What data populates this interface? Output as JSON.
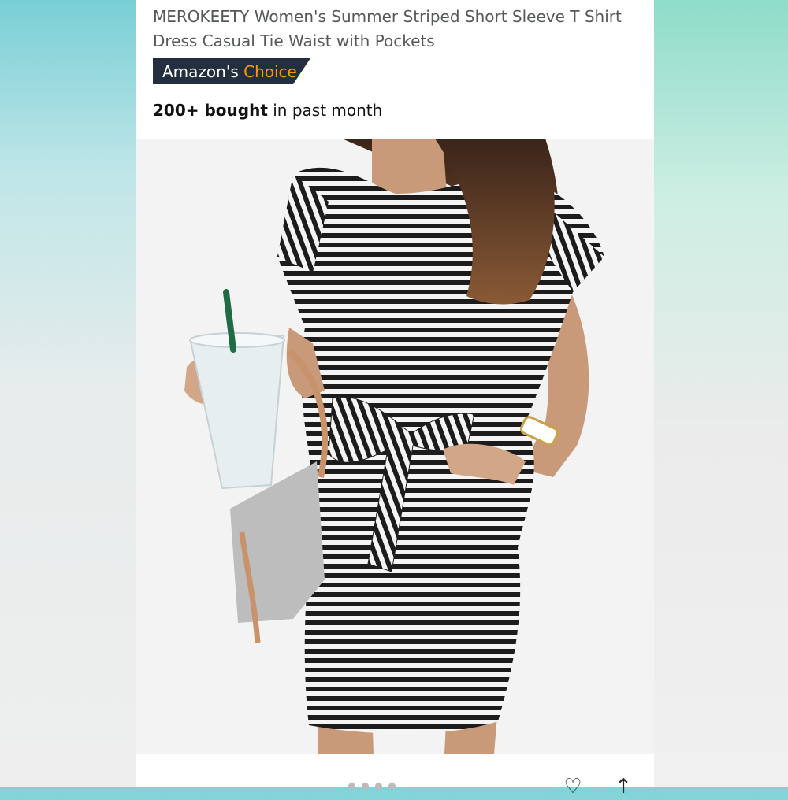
{
  "product": {
    "title": "MEROKEETY Women's Summer Striped Short Sleeve T Shirt Dress Casual Tie Waist with Pockets"
  },
  "badge": {
    "prefix": "Amazon's",
    "highlight": "Choice",
    "bg_color": "#232f3e",
    "highlight_color": "#ff9900"
  },
  "social_proof": {
    "count": "200+ bought",
    "suffix": "in past month"
  },
  "image": {
    "subject": "woman-in-striped-dress-photo"
  },
  "actions": {
    "icons": [
      "heart-icon",
      "share-icon"
    ]
  }
}
